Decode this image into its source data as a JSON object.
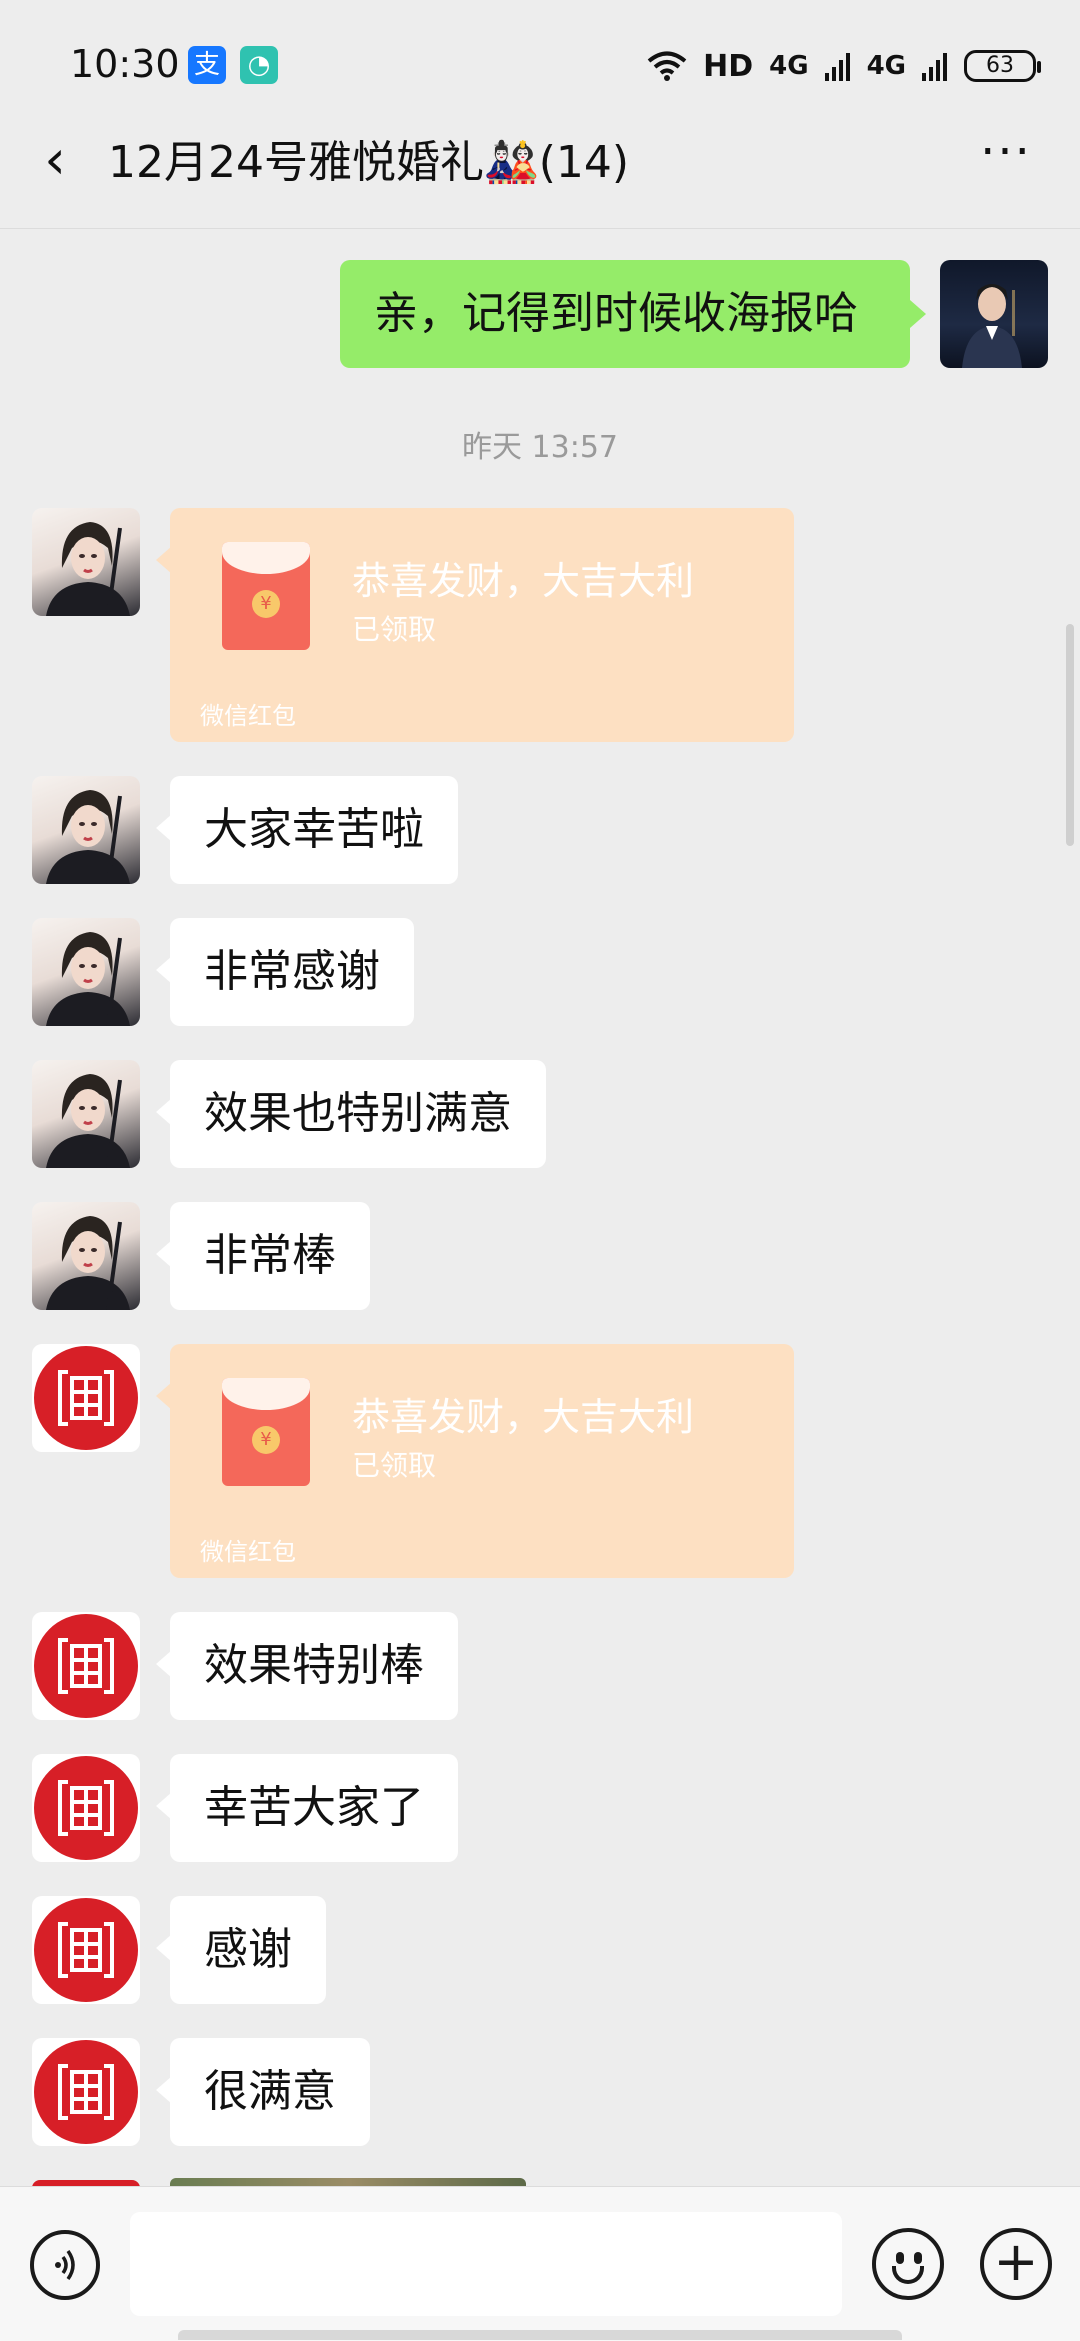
{
  "status_bar": {
    "time": "10:30",
    "app_icons": [
      {
        "name": "alipay-icon",
        "glyph": "支",
        "color": "#1677ff"
      },
      {
        "name": "chat-bubble-icon",
        "glyph": "◔",
        "color": "#2fc2b0"
      }
    ],
    "hd": "HD",
    "signal_1": "4G",
    "signal_2": "4G",
    "battery": "63"
  },
  "header": {
    "title": "12月24号雅悦婚礼🎎(14)",
    "back_icon": "‹",
    "more_icon": "···"
  },
  "messages": {
    "outgoing_text": "亲，记得到时候收海报哈",
    "timestamp": "昨天 13:57",
    "red_packet_1": {
      "title": "恭喜发财，大吉大利",
      "status": "已领取",
      "label": "微信红包",
      "coin": "¥"
    },
    "msg_1": "大家幸苦啦",
    "msg_2": "非常感谢",
    "msg_3": "效果也特别满意",
    "msg_4": "非常棒",
    "red_packet_2": {
      "title": "恭喜发财，大吉大利",
      "status": "已领取",
      "label": "微信红包",
      "coin": "¥"
    },
    "msg_5": "效果特别棒",
    "msg_6": "幸苦大家了",
    "msg_7": "感谢",
    "msg_8": "很满意"
  },
  "input_bar": {
    "voice_icon": "🔊",
    "input_value": "",
    "plus_icon": "+"
  },
  "colors": {
    "background": "#ededed",
    "self_bubble": "#95ec69",
    "other_bubble": "#ffffff",
    "red_packet": "#fde0c2",
    "logo_red": "#d71f27"
  }
}
